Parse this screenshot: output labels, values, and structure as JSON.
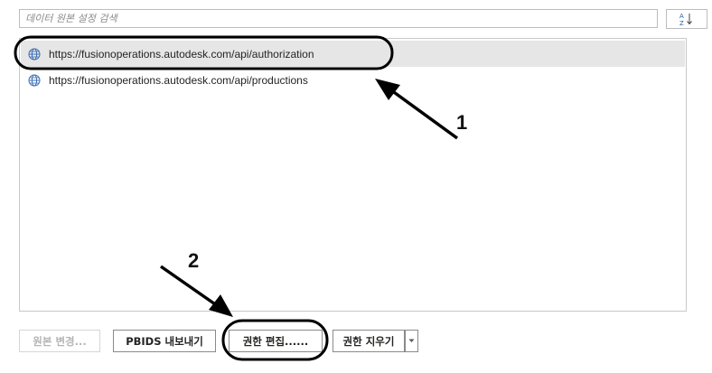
{
  "search": {
    "placeholder": "데이터 원본 설정 검색"
  },
  "sort_button": {
    "icon": "sort-az-icon"
  },
  "list": {
    "items": [
      {
        "url": "https://fusionoperations.autodesk.com/api/authorization",
        "icon": "globe-icon",
        "selected": true
      },
      {
        "url": "https://fusionoperations.autodesk.com/api/productions",
        "icon": "globe-icon",
        "selected": false
      }
    ]
  },
  "buttons": {
    "change_source": "원본 변경...",
    "export_pbids": "PBIDS 내보내기",
    "edit_permissions": "권한 편집......",
    "clear_permissions": "권한 지우기"
  },
  "annotations": {
    "label_1": "1",
    "label_2": "2"
  },
  "colors": {
    "selected_row": "#e6e6e6",
    "annotation": "#000000"
  }
}
